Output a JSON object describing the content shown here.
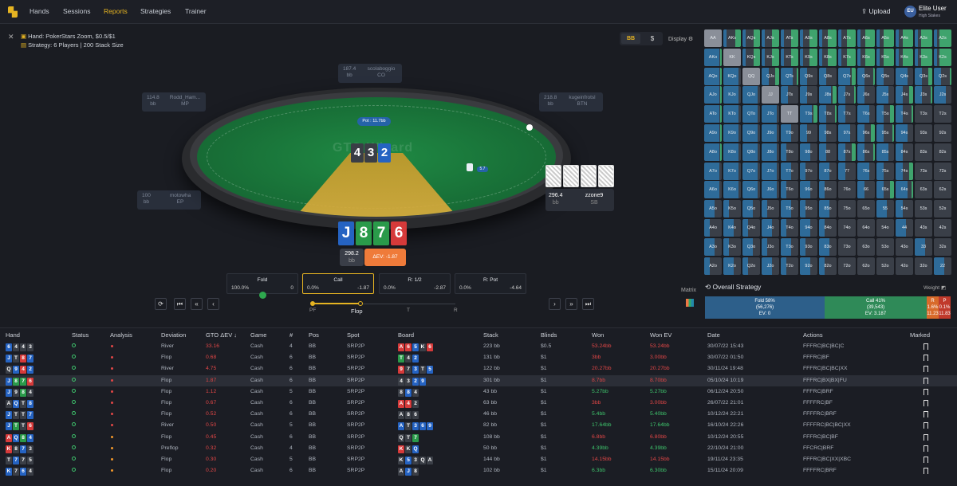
{
  "nav": {
    "items": [
      "Hands",
      "Sessions",
      "Reports",
      "Strategies",
      "Trainer"
    ],
    "active": "Reports",
    "upload": "Upload",
    "avatar": "EU",
    "user": "Elite User",
    "user_sub": "High Stakes"
  },
  "hand": {
    "title": "Hand:  PokerStars Zoom, $0.5/$1",
    "strategy": "Strategy: 6 Players | 200 Stack Size"
  },
  "toggle": {
    "bb": "BB",
    "dollar": "$",
    "display": "Display"
  },
  "table": {
    "pot": "Pot : 11.7bb",
    "watermark": "GTO Wizard",
    "board": [
      {
        "r": "4",
        "c": "#3a3e46"
      },
      {
        "r": "3",
        "c": "#3a3e46"
      },
      {
        "r": "2",
        "c": "#2563c2"
      }
    ],
    "hero_cards": [
      {
        "r": "J",
        "c": "#2563c2"
      },
      {
        "r": "8",
        "c": "#2a9a4a"
      },
      {
        "r": "7",
        "c": "#2a9a4a"
      },
      {
        "r": "6",
        "c": "#d63a3a"
      }
    ],
    "hero_stack": "298.2",
    "hero_unit": "bb",
    "hero_ev": "ΔEV: -1.87",
    "chip_val": "5.7",
    "seats": [
      {
        "stack": "187.4",
        "unit": "bb",
        "name": "scolaboggio",
        "pos": "CO"
      },
      {
        "stack": "114.8",
        "unit": "bb",
        "name": "Rodd_Ham...",
        "pos": "MP"
      },
      {
        "stack": "218.8",
        "unit": "bb",
        "name": "kugeinfrotsl",
        "pos": "BTN"
      },
      {
        "stack": "100",
        "unit": "bb",
        "name": "motowha",
        "pos": "EP"
      }
    ],
    "sb": {
      "stack": "296.4",
      "unit": "bb",
      "name": "zzone9",
      "pos": "SB"
    }
  },
  "actions": [
    {
      "name": "Fold",
      "pct": "100.0%",
      "ev": "0"
    },
    {
      "name": "Call",
      "pct": "0.0%",
      "ev": "-1.87"
    },
    {
      "name": "R: 1/2",
      "pct": "0.0%",
      "ev": "-2.87"
    },
    {
      "name": "R: Pot",
      "pct": "0.0%",
      "ev": "-4.64"
    }
  ],
  "streets": [
    "PF",
    "Flop",
    "T",
    "R"
  ],
  "matrix_label": "Matrix",
  "overall": {
    "title": "Overall Strategy",
    "weight": "Weight",
    "fold": {
      "l1": "Fold 58%",
      "l2": "(56,276)",
      "l3": "EV: 0"
    },
    "call": {
      "l1": "Call 41%",
      "l2": "(39,543)",
      "l3": "EV: 3.187"
    },
    "r": {
      "l1": "R",
      "l2": "1.6%",
      "l3": "11.23"
    },
    "p": {
      "l1": "P",
      "l2": "0.1%",
      "l3": "11.83"
    }
  },
  "matrix": [
    "AA",
    "AKs",
    "AQs",
    "AJs",
    "ATs",
    "A9s",
    "A8s",
    "A7s",
    "A6s",
    "A5s",
    "A4s",
    "A3s",
    "A2s",
    "AKo",
    "KK",
    "KQs",
    "KJs",
    "KTs",
    "K9s",
    "K8s",
    "K7s",
    "K6s",
    "K5s",
    "K4s",
    "K3s",
    "K2s",
    "AQo",
    "KQo",
    "QQ",
    "QJs",
    "QTs",
    "Q9s",
    "Q8s",
    "Q7s",
    "Q6s",
    "Q5s",
    "Q4s",
    "Q3s",
    "Q2s",
    "AJo",
    "KJo",
    "QJo",
    "JJ",
    "JTs",
    "J9s",
    "J8s",
    "J7s",
    "J6s",
    "J5s",
    "J4s",
    "J3s",
    "J2s",
    "ATo",
    "KTo",
    "QTo",
    "JTo",
    "TT",
    "T9s",
    "T8s",
    "T7s",
    "T6s",
    "T5s",
    "T4s",
    "T3s",
    "T2s",
    "A9o",
    "K9o",
    "Q9o",
    "J9o",
    "T9o",
    "99",
    "98s",
    "97s",
    "96s",
    "95s",
    "94s",
    "93s",
    "92s",
    "A8o",
    "K8o",
    "Q8o",
    "J8o",
    "T8o",
    "98o",
    "88",
    "87s",
    "86s",
    "85s",
    "84s",
    "83s",
    "82s",
    "A7o",
    "K7o",
    "Q7o",
    "J7o",
    "T7o",
    "97o",
    "87o",
    "77",
    "76s",
    "75s",
    "74s",
    "73s",
    "72s",
    "A6o",
    "K6o",
    "Q6o",
    "J6o",
    "T6o",
    "96o",
    "86o",
    "76o",
    "66",
    "65s",
    "64s",
    "63s",
    "62s",
    "A5o",
    "K5o",
    "Q5o",
    "J5o",
    "T5o",
    "95o",
    "85o",
    "75o",
    "65o",
    "55",
    "54s",
    "53s",
    "52s",
    "A4o",
    "K4o",
    "Q4o",
    "J4o",
    "T4o",
    "94o",
    "84o",
    "74o",
    "64o",
    "54o",
    "44",
    "43s",
    "42s",
    "A3o",
    "K3o",
    "Q3o",
    "J3o",
    "T3o",
    "93o",
    "83o",
    "73o",
    "63o",
    "53o",
    "43o",
    "33",
    "32s",
    "A2o",
    "K2o",
    "Q2o",
    "J2o",
    "T2o",
    "92o",
    "82o",
    "72o",
    "62o",
    "52o",
    "42o",
    "32o",
    "22"
  ],
  "list": {
    "headers": [
      "Hand",
      "Status",
      "Analysis",
      "Deviation",
      "GTO ΔEV ↓",
      "Game",
      "#",
      "Pos",
      "Spot",
      "Board",
      "Stack",
      "Blinds",
      "Won",
      "Won EV",
      "Date",
      "Actions",
      "Marked"
    ],
    "rows": [
      {
        "hand": [
          [
            "6",
            "#2563c2"
          ],
          [
            "4",
            "#3a3e46"
          ],
          [
            "4",
            "#3a3e46"
          ],
          [
            "3",
            "#3a3e46"
          ]
        ],
        "st": "ok",
        "an": "red",
        "dev": "River",
        "ev": "33.16",
        "game": "Cash",
        "n": "4",
        "pos": "BB",
        "spot": "SRP2P",
        "board": [
          [
            "A",
            "#d63a3a"
          ],
          [
            "6",
            "#d63a3a"
          ],
          [
            "5",
            "#2563c2"
          ],
          [
            "K",
            "#3a3e46"
          ],
          [
            "6",
            "#d63a3a"
          ]
        ],
        "stack": "223 bb",
        "bl": "$0.5",
        "won": "53.24bb",
        "wc": "red",
        "wev": "53.24bb",
        "date": "30/07/22 15:43",
        "act": "FFFRC|BC|BC|C"
      },
      {
        "hand": [
          [
            "J",
            "#2563c2"
          ],
          [
            "T",
            "#3a3e46"
          ],
          [
            "8",
            "#d63a3a"
          ],
          [
            "7",
            "#2563c2"
          ]
        ],
        "st": "ok",
        "an": "red",
        "dev": "Flop",
        "ev": "0.68",
        "game": "Cash",
        "n": "6",
        "pos": "BB",
        "spot": "SRP2P",
        "board": [
          [
            "T",
            "#2a9a4a"
          ],
          [
            "4",
            "#3a3e46"
          ],
          [
            "2",
            "#2563c2"
          ]
        ],
        "stack": "131 bb",
        "bl": "$1",
        "won": "3bb",
        "wc": "red",
        "wev": "3.00bb",
        "date": "30/07/22 01:50",
        "act": "FFFRC|BF"
      },
      {
        "hand": [
          [
            "Q",
            "#3a3e46"
          ],
          [
            "9",
            "#2563c2"
          ],
          [
            "4",
            "#d63a3a"
          ],
          [
            "2",
            "#2563c2"
          ]
        ],
        "st": "ok",
        "an": "red",
        "dev": "River",
        "ev": "4.75",
        "game": "Cash",
        "n": "6",
        "pos": "BB",
        "spot": "SRP2P",
        "board": [
          [
            "9",
            "#d63a3a"
          ],
          [
            "7",
            "#3a3e46"
          ],
          [
            "3",
            "#2563c2"
          ],
          [
            "T",
            "#3a3e46"
          ],
          [
            "5",
            "#2563c2"
          ]
        ],
        "stack": "122 bb",
        "bl": "$1",
        "won": "20.27bb",
        "wc": "red",
        "wev": "20.27bb",
        "date": "30/11/24 19:48",
        "act": "FFFRC|BC|BC|XX"
      },
      {
        "hand": [
          [
            "J",
            "#2563c2"
          ],
          [
            "8",
            "#2a9a4a"
          ],
          [
            "7",
            "#2a9a4a"
          ],
          [
            "6",
            "#d63a3a"
          ]
        ],
        "st": "sel",
        "an": "red",
        "dev": "Flop",
        "ev": "1.87",
        "game": "Cash",
        "n": "6",
        "pos": "BB",
        "spot": "SRP2P",
        "board": [
          [
            "4",
            "#3a3e46"
          ],
          [
            "3",
            "#3a3e46"
          ],
          [
            "2",
            "#2563c2"
          ],
          [
            "9",
            "#2563c2"
          ]
        ],
        "stack": "301 bb",
        "bl": "$1",
        "won": "8.7bb",
        "wc": "red",
        "wev": "8.70bb",
        "date": "05/10/24 10:19",
        "act": "FFFRC|BX|BX|FU"
      },
      {
        "hand": [
          [
            "J",
            "#2563c2"
          ],
          [
            "9",
            "#3a3e46"
          ],
          [
            "8",
            "#2a9a4a"
          ],
          [
            "4",
            "#3a3e46"
          ]
        ],
        "st": "ok",
        "an": "red",
        "dev": "Flop",
        "ev": "1.12",
        "game": "Cash",
        "n": "5",
        "pos": "BB",
        "spot": "SRP2P",
        "board": [
          [
            "8",
            "#3a3e46"
          ],
          [
            "8",
            "#2563c2"
          ],
          [
            "4",
            "#3a3e46"
          ]
        ],
        "stack": "43 bb",
        "bl": "$1",
        "won": "5.27bb",
        "wc": "green",
        "wev": "5.27bb",
        "date": "06/12/24 20:50",
        "act": "FFFRC|BRF"
      },
      {
        "hand": [
          [
            "A",
            "#3a3e46"
          ],
          [
            "Q",
            "#2563c2"
          ],
          [
            "T",
            "#3a3e46"
          ],
          [
            "8",
            "#2563c2"
          ]
        ],
        "st": "ok",
        "an": "red",
        "dev": "Flop",
        "ev": "0.67",
        "game": "Cash",
        "n": "6",
        "pos": "BB",
        "spot": "SRP2P",
        "board": [
          [
            "A",
            "#d63a3a"
          ],
          [
            "4",
            "#d63a3a"
          ],
          [
            "2",
            "#3a3e46"
          ]
        ],
        "stack": "63 bb",
        "bl": "$1",
        "won": "3bb",
        "wc": "red",
        "wev": "3.00bb",
        "date": "26/07/22 21:01",
        "act": "FFFFRC|BF"
      },
      {
        "hand": [
          [
            "J",
            "#2563c2"
          ],
          [
            "T",
            "#3a3e46"
          ],
          [
            "T",
            "#3a3e46"
          ],
          [
            "7",
            "#2563c2"
          ]
        ],
        "st": "ok",
        "an": "red",
        "dev": "Flop",
        "ev": "0.52",
        "game": "Cash",
        "n": "6",
        "pos": "BB",
        "spot": "SRP2P",
        "board": [
          [
            "A",
            "#3a3e46"
          ],
          [
            "8",
            "#3a3e46"
          ],
          [
            "6",
            "#3a3e46"
          ]
        ],
        "stack": "46 bb",
        "bl": "$1",
        "won": "5.4bb",
        "wc": "green",
        "wev": "5.40bb",
        "date": "10/12/24 22:21",
        "act": "FFFFRC|BRF"
      },
      {
        "hand": [
          [
            "J",
            "#2563c2"
          ],
          [
            "T",
            "#2a9a4a"
          ],
          [
            "T",
            "#3a3e46"
          ],
          [
            "6",
            "#d63a3a"
          ]
        ],
        "st": "ok",
        "an": "red",
        "dev": "River",
        "ev": "0.50",
        "game": "Cash",
        "n": "5",
        "pos": "BB",
        "spot": "SRP2P",
        "board": [
          [
            "A",
            "#2563c2"
          ],
          [
            "T",
            "#3a3e46"
          ],
          [
            "3",
            "#2563c2"
          ],
          [
            "6",
            "#2563c2"
          ],
          [
            "9",
            "#2563c2"
          ]
        ],
        "stack": "82 bb",
        "bl": "$1",
        "won": "17.64bb",
        "wc": "green",
        "wev": "17.64bb",
        "date": "16/10/24 22:26",
        "act": "FFFFRC|BC|BC|XX"
      },
      {
        "hand": [
          [
            "A",
            "#d63a3a"
          ],
          [
            "Q",
            "#2563c2"
          ],
          [
            "8",
            "#2a9a4a"
          ],
          [
            "4",
            "#2563c2"
          ]
        ],
        "st": "ok",
        "an": "orange",
        "dev": "Flop",
        "ev": "0.45",
        "game": "Cash",
        "n": "6",
        "pos": "BB",
        "spot": "SRP2P",
        "board": [
          [
            "Q",
            "#3a3e46"
          ],
          [
            "T",
            "#3a3e46"
          ],
          [
            "7",
            "#2a9a4a"
          ]
        ],
        "stack": "108 bb",
        "bl": "$1",
        "won": "6.8bb",
        "wc": "red",
        "wev": "6.80bb",
        "date": "10/12/24 20:55",
        "act": "FFFRC|BC|BF"
      },
      {
        "hand": [
          [
            "K",
            "#d63a3a"
          ],
          [
            "8",
            "#3a3e46"
          ],
          [
            "7",
            "#2563c2"
          ],
          [
            "3",
            "#3a3e46"
          ]
        ],
        "st": "ok",
        "an": "orange",
        "dev": "Preflop",
        "ev": "0.32",
        "game": "Cash",
        "n": "4",
        "pos": "BB",
        "spot": "SRP2P",
        "board": [
          [
            "K",
            "#d63a3a"
          ],
          [
            "K",
            "#3a3e46"
          ],
          [
            "Q",
            "#2563c2"
          ]
        ],
        "stack": "50 bb",
        "bl": "$1",
        "won": "4.39bb",
        "wc": "green",
        "wev": "4.39bb",
        "date": "22/10/24 21:00",
        "act": "FFCRC|BRF"
      },
      {
        "hand": [
          [
            "T",
            "#3a3e46"
          ],
          [
            "7",
            "#2563c2"
          ],
          [
            "7",
            "#3a3e46"
          ],
          [
            "5",
            "#3a3e46"
          ]
        ],
        "st": "ok",
        "an": "orange",
        "dev": "Flop",
        "ev": "0.30",
        "game": "Cash",
        "n": "5",
        "pos": "BB",
        "spot": "SRP2P",
        "board": [
          [
            "K",
            "#3a3e46"
          ],
          [
            "5",
            "#2563c2"
          ],
          [
            "3",
            "#3a3e46"
          ],
          [
            "Q",
            "#3a3e46"
          ],
          [
            "A",
            "#3a3e46"
          ]
        ],
        "stack": "144 bb",
        "bl": "$1",
        "won": "14.15bb",
        "wc": "red",
        "wev": "14.15bb",
        "date": "19/11/24 23:35",
        "act": "FFFRC|BC|XX|XBC"
      },
      {
        "hand": [
          [
            "K",
            "#2563c2"
          ],
          [
            "7",
            "#3a3e46"
          ],
          [
            "6",
            "#2563c2"
          ],
          [
            "4",
            "#3a3e46"
          ]
        ],
        "st": "ok",
        "an": "orange",
        "dev": "Flop",
        "ev": "0.20",
        "game": "Cash",
        "n": "6",
        "pos": "BB",
        "spot": "SRP2P",
        "board": [
          [
            "A",
            "#3a3e46"
          ],
          [
            "J",
            "#2563c2"
          ],
          [
            "8",
            "#3a3e46"
          ]
        ],
        "stack": "102 bb",
        "bl": "$1",
        "won": "6.3bb",
        "wc": "green",
        "wev": "6.30bb",
        "date": "15/11/24 20:09",
        "act": "FFFFRC|BRF"
      }
    ]
  }
}
